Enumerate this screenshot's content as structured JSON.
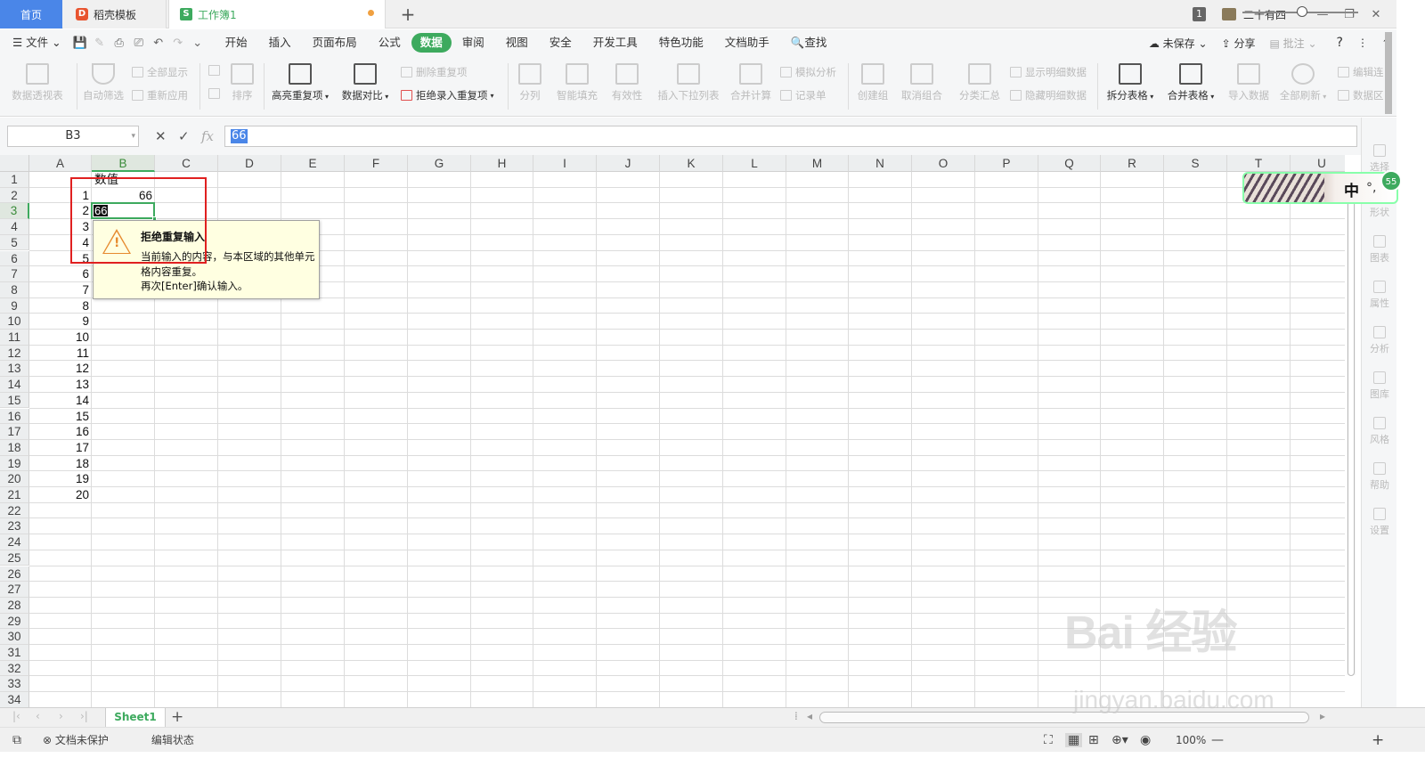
{
  "tabs": {
    "home": "首页",
    "template": "稻壳模板",
    "workbook": "工作簿1",
    "add": "+"
  },
  "window": {
    "badge": "1",
    "user": "二十有四",
    "minimize": "—",
    "restore": "❐",
    "close": "✕"
  },
  "menu": {
    "file": "☰ 文件 ⌄",
    "items": [
      "开始",
      "插入",
      "页面布局",
      "公式",
      "数据",
      "审阅",
      "视图",
      "安全",
      "开发工具",
      "特色功能",
      "文档助手",
      "🔍查找"
    ],
    "active_index": 4,
    "right": {
      "unsaved": "未保存",
      "share": "分享",
      "comment": "批注",
      "help": "?",
      "more": "⋮",
      "collapse": "^"
    }
  },
  "ribbon": {
    "pivot": "数据透视表",
    "autofilter": "自动筛选",
    "show_all": "全部显示",
    "reapply": "重新应用",
    "sort": "排序",
    "highlight_dup": "高亮重复项",
    "compare": "数据对比",
    "delete_dup": "删除重复项",
    "reject_dup": "拒绝录入重复项",
    "split_col": "分列",
    "smart_fill": "智能填充",
    "validity": "有效性",
    "insert_dropdown": "插入下拉列表",
    "merge_calc": "合并计算",
    "simulate": "模拟分析",
    "record": "记录单",
    "create_group": "创建组",
    "ungroup": "取消组合",
    "subtotal": "分类汇总",
    "show_detail": "显示明细数据",
    "hide_detail": "隐藏明细数据",
    "split_table": "拆分表格",
    "merge_table": "合并表格",
    "import_data": "导入数据",
    "refresh_all": "全部刷新",
    "edit_link": "编辑连",
    "data_area": "数据区"
  },
  "formula_bar": {
    "name_box": "B3",
    "cancel": "✕",
    "confirm": "✓",
    "fx": "fx",
    "value": "66"
  },
  "columns": [
    "A",
    "B",
    "C",
    "D",
    "E",
    "F",
    "G",
    "H",
    "I",
    "J",
    "K",
    "L",
    "M",
    "N",
    "O",
    "P",
    "Q",
    "R",
    "S",
    "T",
    "U"
  ],
  "selected_column": "B",
  "rows": [
    "1",
    "2",
    "3",
    "4",
    "5",
    "6",
    "7",
    "8",
    "9",
    "10",
    "11",
    "12",
    "13",
    "14",
    "15",
    "16",
    "17",
    "18",
    "19",
    "20",
    "21",
    "22",
    "23",
    "24",
    "25",
    "26",
    "27",
    "28",
    "29",
    "30",
    "31",
    "32",
    "33",
    "34"
  ],
  "selected_row": "3",
  "cells": {
    "B1": "数值",
    "B2": "66",
    "B3_edit": "66",
    "A_values": [
      "1",
      "2",
      "3",
      "4",
      "5",
      "6",
      "7",
      "8",
      "9",
      "10",
      "11",
      "12",
      "13",
      "14",
      "15",
      "16",
      "17",
      "18",
      "19",
      "20"
    ]
  },
  "warning": {
    "title": "拒绝重复输入",
    "line1": "当前输入的内容，与本区域的其他单元",
    "line2": "格内容重复。",
    "line3": "再次[Enter]确认输入。"
  },
  "sheets": {
    "active": "Sheet1",
    "add": "+"
  },
  "status": {
    "protect": "文档未保护",
    "mode": "编辑状态",
    "zoom": "100%",
    "zoom_out": "—",
    "zoom_in": "+"
  },
  "right_panel": [
    "选择",
    "形状",
    "图表",
    "属性",
    "分析",
    "图库",
    "风格",
    "帮助",
    "设置"
  ],
  "float_widget": {
    "text": "中",
    "dot": "°,",
    "badge": "55"
  },
  "watermark": {
    "main": "Bai 经验",
    "url": "jingyan.baidu.com"
  },
  "colors": {
    "accent": "#3daa5e",
    "tab_home": "#4a86e8",
    "highlight_border": "#e02020",
    "tooltip_bg": "#ffffe1"
  }
}
